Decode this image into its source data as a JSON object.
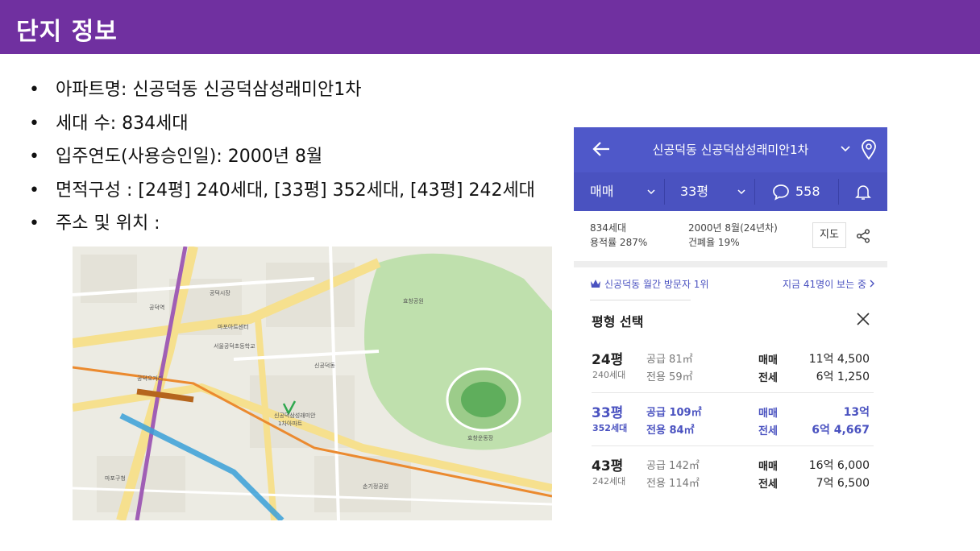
{
  "header": {
    "title": "단지 정보"
  },
  "bullets": [
    "아파트명: 신공덕동 신공덕삼성래미안1차",
    "세대 수: 834세대",
    "입주연도(사용승인일): 2000년 8월",
    "면적구성 : [24평] 240세대, [33평] 352세대, [43평] 242세대",
    "주소  및 위치 :"
  ],
  "map": {
    "labels": [
      "신공덕동",
      "아파트",
      "효창공원",
      "공덕오거리",
      "공덕역",
      "마포구청",
      "서울공덕초등학교",
      "효창운동장",
      "손기정공원",
      "공덕시장",
      "마포아트센터",
      "신공덕삼성래미안1차아파트"
    ]
  },
  "panel": {
    "topbar": {
      "title": "신공덕동 신공덕삼성래미안1차"
    },
    "filters": {
      "trade": "매매",
      "size": "33평",
      "comments": "558"
    },
    "info": {
      "households": "834세대",
      "far": "용적률 287%",
      "built": "2000년 8월(24년차)",
      "bcr": "건폐율 19%",
      "map_button": "지도"
    },
    "visitor": {
      "rank": "신공덕동 월간 방문자 1위",
      "viewers": "지금 41명이 보는 중"
    },
    "select_title": "평형 선택",
    "units": [
      {
        "size": "24평",
        "households": "240세대",
        "supply": "공급 81㎡",
        "exclusive": "전용 59㎡",
        "sale_label": "매매",
        "sale_price": "11억 4,500",
        "jeonse_label": "전세",
        "jeonse_price": "6억 1,250",
        "selected": false
      },
      {
        "size": "33평",
        "households": "352세대",
        "supply": "공급 109㎡",
        "exclusive": "전용 84㎡",
        "sale_label": "매매",
        "sale_price": "13억",
        "jeonse_label": "전세",
        "jeonse_price": "6억 4,667",
        "selected": true
      },
      {
        "size": "43평",
        "households": "242세대",
        "supply": "공급 142㎡",
        "exclusive": "전용 114㎡",
        "sale_label": "매매",
        "sale_price": "16억 6,000",
        "jeonse_label": "전세",
        "jeonse_price": "7억 6,500",
        "selected": false
      }
    ]
  },
  "colors": {
    "header": "#7030a0",
    "accent": "#4f58c9",
    "park": "#a8d58f"
  }
}
